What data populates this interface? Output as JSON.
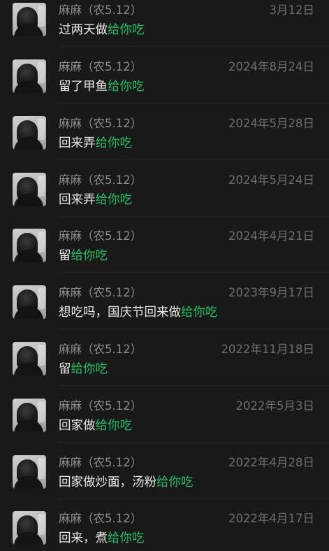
{
  "colors": {
    "background": "#191919",
    "name": "#8d8d8d",
    "date": "#6d6d6d",
    "message": "#e8e8e8",
    "highlight": "#20c162"
  },
  "items": [
    {
      "name": "麻麻（农5.12）",
      "date": "3月12日",
      "prefix": "过两天做",
      "highlight": "给你吃"
    },
    {
      "name": "麻麻（农5.12）",
      "date": "2024年8月24日",
      "prefix": "留了甲鱼",
      "highlight": "给你吃"
    },
    {
      "name": "麻麻（农5.12）",
      "date": "2024年5月28日",
      "prefix": "回来弄",
      "highlight": "给你吃"
    },
    {
      "name": "麻麻（农5.12）",
      "date": "2024年5月24日",
      "prefix": "回来弄",
      "highlight": "给你吃"
    },
    {
      "name": "麻麻（农5.12）",
      "date": "2024年4月21日",
      "prefix": "留",
      "highlight": "给你吃"
    },
    {
      "name": "麻麻（农5.12）",
      "date": "2023年9月17日",
      "prefix": "想吃吗，国庆节回来做",
      "highlight": "给你吃"
    },
    {
      "name": "麻麻（农5.12）",
      "date": "2022年11月18日",
      "prefix": "留",
      "highlight": "给你吃"
    },
    {
      "name": "麻麻（农5.12）",
      "date": "2022年5月3日",
      "prefix": "回家做",
      "highlight": "给你吃"
    },
    {
      "name": "麻麻（农5.12）",
      "date": "2022年4月28日",
      "prefix": "回家做炒面，汤粉",
      "highlight": "给你吃"
    },
    {
      "name": "麻麻（农5.12）",
      "date": "2022年4月17日",
      "prefix": "回来，煮",
      "highlight": "给你吃"
    }
  ]
}
